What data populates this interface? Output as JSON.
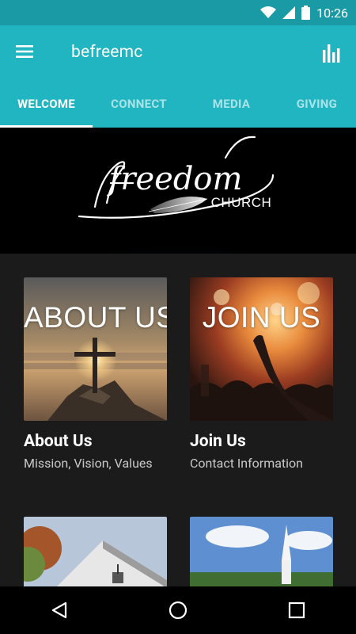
{
  "status_bar": {
    "time": "10:26",
    "icons": [
      "wifi-icon",
      "cell-signal-icon",
      "battery-icon"
    ]
  },
  "app_bar": {
    "title": "befreemc",
    "menu_icon": "hamburger-menu-icon",
    "action_icon": "stats-bars-icon"
  },
  "tabs": [
    {
      "label": "WELCOME",
      "active": true
    },
    {
      "label": "CONNECT",
      "active": false
    },
    {
      "label": "MEDIA",
      "active": false
    },
    {
      "label": "GIVING",
      "active": false
    }
  ],
  "banner": {
    "logo_script": "freedom",
    "logo_word": "CHURCH"
  },
  "cards": [
    {
      "overlay": "ABOUT US",
      "title": "About Us",
      "subtitle": "Mission, Vision, Values"
    },
    {
      "overlay": "JOIN US",
      "title": "Join Us",
      "subtitle": "Contact Information"
    }
  ],
  "nav_bar": {
    "icons": [
      "back-icon",
      "home-icon",
      "recents-icon"
    ]
  },
  "colors": {
    "primary": "#20b5c0",
    "status_bar": "#199aa4",
    "background": "#1b1b1c"
  }
}
